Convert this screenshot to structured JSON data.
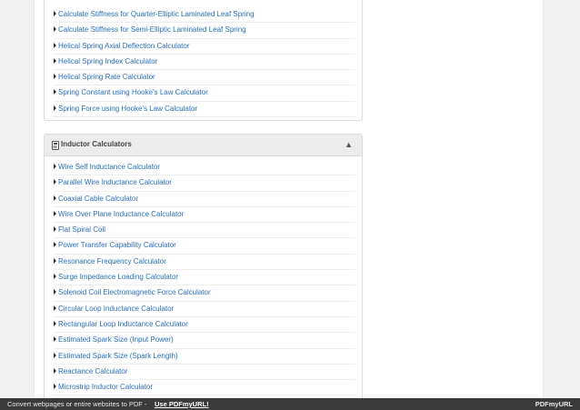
{
  "top_panel": {
    "items": [
      "Calculate Stiffness for Quarter-Elliptic Laminated Leaf Spring",
      "Calculate Stiffness for Semi-Elliptic Laminated Leaf Spring",
      "Helical Spring Axial Deflection Calculator",
      "Helical Spring Index Calculator",
      "Helical Spring Rate Calculator",
      "Spring Constant using Hooke's Law Calculator",
      "Spring Force using Hooke's Law Calculator"
    ]
  },
  "inductor_panel": {
    "title": "Inductor Calculators",
    "items": [
      "Wire Self Inductance Calculator",
      "Parallel Wire Inductance Calculator",
      "Coaxial Cable Calculator",
      "Wire Over Plane Inductance Calculator",
      "Flat Spiral Coil",
      "Power Transfer Capability Calculator",
      "Resonance Frequency Calculator",
      "Surge Impedance Loading Calculator",
      "Solenoid Coil Electromagnetic Force Calculator",
      "Circular Loop Inductance Calculator",
      "Rectangular Loop Inductance Calculator",
      "Estimated Spark Size (Input Power)",
      "Estimated Spark Size (Spark Length)",
      "Reactance Calculator",
      "Microstrip Inductor Calculator"
    ]
  },
  "footer": {
    "text": "Convert webpages or entire websites to PDF -",
    "link": "Use PDFmyURL!",
    "logo_a": "PDF",
    "logo_b": "myURL"
  },
  "colors": {
    "link": "#2a6ebb",
    "heading_bg": "#ececec",
    "footer_bg": "#3a3a3a"
  },
  "icons": {
    "bullet": "caret-right-icon",
    "heading": "calculator-icon",
    "collapse": "arrow-up-icon"
  }
}
